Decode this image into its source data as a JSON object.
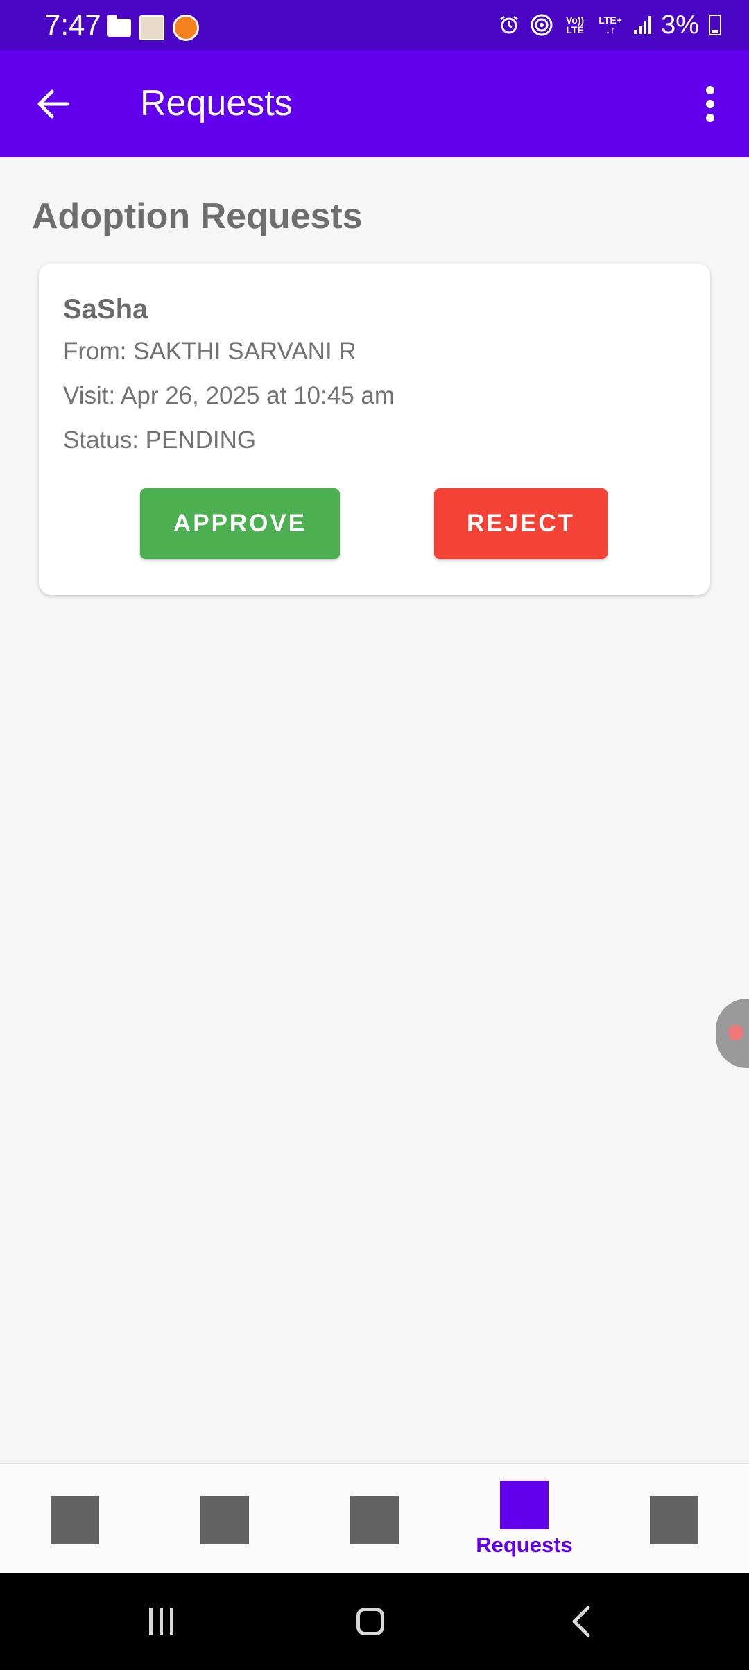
{
  "status_bar": {
    "time": "7:47",
    "battery": "3%",
    "network_small_1": "Vo)) LTE",
    "network_small_2": "LTE+ ↓↑"
  },
  "app_bar": {
    "title": "Requests",
    "color": "#6200ee"
  },
  "main": {
    "section_title": "Adoption Requests",
    "requests": [
      {
        "pet_name": "SaSha",
        "from": "From: SAKTHI SARVANI R",
        "visit": "Visit: Apr 26, 2025 at 10:45 am",
        "status": "Status: PENDING",
        "approve_label": "APPROVE",
        "reject_label": "REJECT"
      }
    ]
  },
  "bottom_nav": {
    "items": [
      {
        "label": "",
        "active": false
      },
      {
        "label": "",
        "active": false
      },
      {
        "label": "",
        "active": false
      },
      {
        "label": "Requests",
        "active": true
      },
      {
        "label": "",
        "active": false
      }
    ]
  },
  "colors": {
    "primary": "#6200ee",
    "approve": "#4caf50",
    "reject": "#f44336",
    "status_bar": "#4a04c4"
  },
  "icons": {
    "back": "arrow-left-icon",
    "overflow": "more-vert-icon",
    "alarm": "alarm-icon",
    "hotspot": "hotspot-icon",
    "signal": "signal-icon",
    "battery": "battery-icon"
  }
}
